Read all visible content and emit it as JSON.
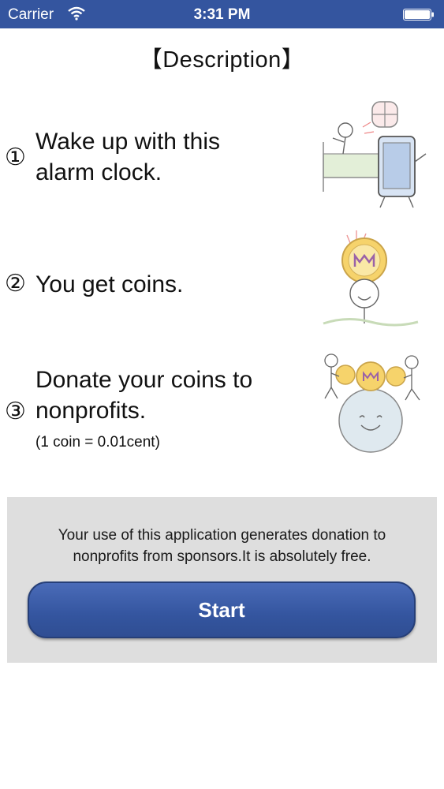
{
  "status_bar": {
    "carrier": "Carrier",
    "time": "3:31 PM",
    "bg_color": "#34559f"
  },
  "title": "【Description】",
  "steps": [
    {
      "number": "①",
      "text_lines": [
        "Wake up with this",
        "alarm clock."
      ],
      "icon": "wake-up-illustration"
    },
    {
      "number": "②",
      "text_lines": [
        "You get coins."
      ],
      "icon": "coin-illustration"
    },
    {
      "number": "③",
      "text_lines": [
        "Donate your coins to",
        "nonprofits."
      ],
      "note": "(1 coin = 0.01cent)",
      "icon": "donate-illustration"
    }
  ],
  "footer": {
    "note_lines": [
      "Your use of this application generates donation to",
      "nonprofits from sponsors.It is absolutely free."
    ],
    "start_label": "Start",
    "button_color": "#34559f",
    "panel_color": "#dedede"
  }
}
